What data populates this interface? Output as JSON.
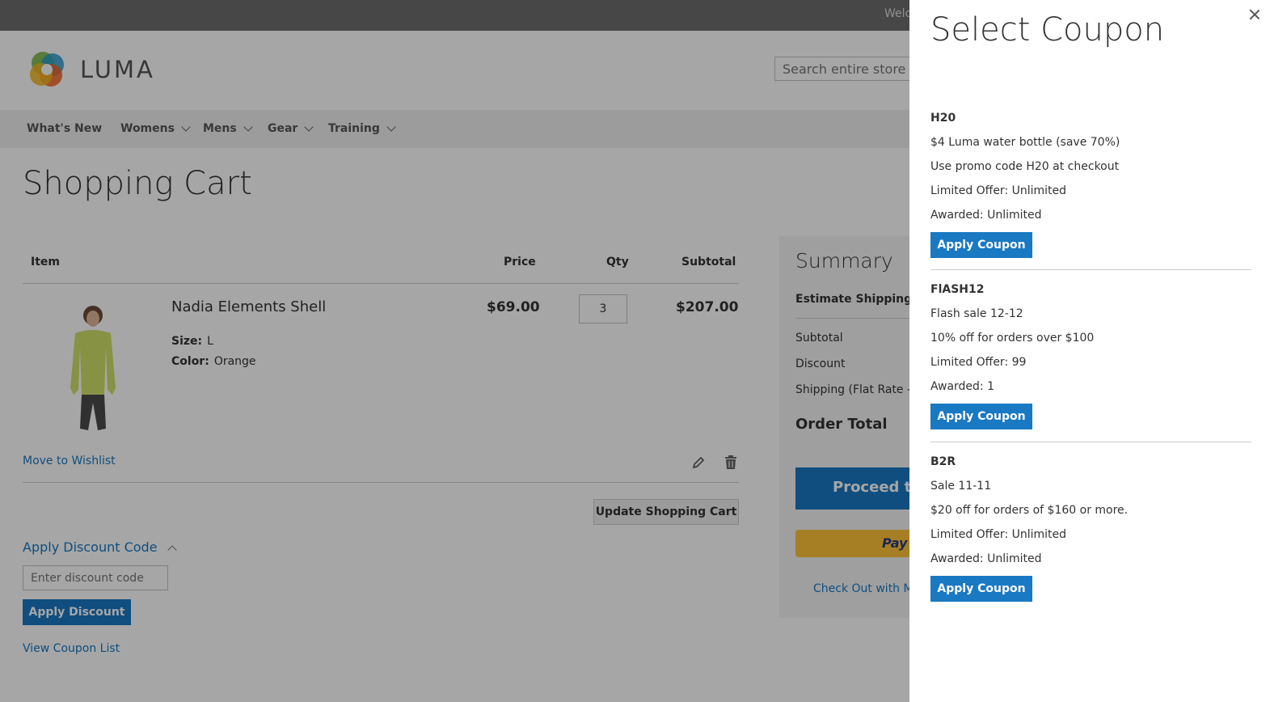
{
  "header": {
    "welcome": "Welc",
    "logo_text": "LUMA",
    "search_placeholder": "Search entire store here..."
  },
  "nav": [
    {
      "label": "What's New",
      "has_dropdown": false
    },
    {
      "label": "Womens",
      "has_dropdown": true
    },
    {
      "label": "Mens",
      "has_dropdown": true
    },
    {
      "label": "Gear",
      "has_dropdown": true
    },
    {
      "label": "Training",
      "has_dropdown": true
    }
  ],
  "page_title": "Shopping Cart",
  "cart": {
    "columns": {
      "item": "Item",
      "price": "Price",
      "qty": "Qty",
      "subtotal": "Subtotal"
    },
    "item": {
      "name": "Nadia Elements Shell",
      "size_label": "Size:",
      "size": "L",
      "color_label": "Color:",
      "color": "Orange",
      "price": "$69.00",
      "qty": "3",
      "subtotal": "$207.00"
    },
    "move_to_wishlist": "Move to Wishlist",
    "update_button": "Update Shopping Cart"
  },
  "discount": {
    "title": "Apply Discount Code",
    "input_placeholder": "Enter discount code",
    "apply_button": "Apply Discount",
    "view_coupons": "View Coupon List"
  },
  "summary": {
    "title": "Summary",
    "estimate": "Estimate Shipping an",
    "subtotal": "Subtotal",
    "discount": "Discount",
    "shipping": "Shipping (Flat Rate - F",
    "order_total": "Order Total",
    "proceed": "Proceed to",
    "paypal": "Pay",
    "multi": "Check Out with Mu"
  },
  "modal": {
    "title": "Select Coupon",
    "apply_label": "Apply Coupon",
    "coupons": [
      {
        "code": "H20",
        "lines": [
          "$4 Luma water bottle (save 70%)",
          "Use promo code H20 at checkout",
          "Limited Offer: Unlimited",
          "Awarded: Unlimited"
        ]
      },
      {
        "code": "FlASH12",
        "lines": [
          "Flash sale 12-12",
          "10% off for orders over $100",
          "Limited Offer: 99",
          "Awarded: 1"
        ]
      },
      {
        "code": "B2R",
        "lines": [
          "Sale 11-11",
          "$20 off for orders of $160 or more.",
          "Limited Offer: Unlimited",
          "Awarded: Unlimited"
        ]
      }
    ]
  },
  "colors": {
    "accent": "#1979c3",
    "paypal": "#ffc439",
    "overlay": "rgba(0,0,0,0.35)"
  }
}
